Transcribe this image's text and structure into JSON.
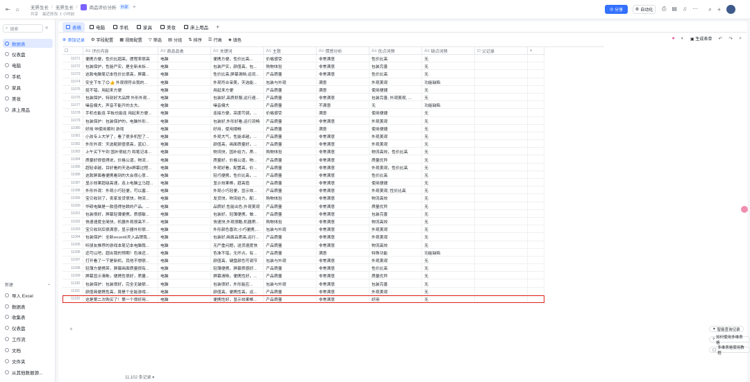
{
  "breadcrumbs": [
    "无界生长",
    "无界生长"
  ],
  "doc_title": "商品评价分析",
  "doc_tag": "外部",
  "doc_sub": [
    "共享",
    "最近修改: 1 小时前"
  ],
  "top": {
    "share": "分享",
    "auto": "自动化"
  },
  "sidebar": {
    "search_placeholder": "搜索",
    "items": [
      {
        "label": "数据表",
        "active": true
      },
      {
        "label": "仪表盘"
      },
      {
        "label": "电脑"
      },
      {
        "label": "手机"
      },
      {
        "label": "家具"
      },
      {
        "label": "美妆"
      },
      {
        "label": "床上用品"
      }
    ],
    "new_section": "新建",
    "new_items": [
      "导入 Excel",
      "数据表",
      "收集表",
      "仪表盘",
      "工作流",
      "文档",
      "文件夹",
      "从其他数据源..."
    ]
  },
  "tabs": [
    "表格",
    "电脑",
    "手机",
    "家具",
    "美妆",
    "床上用品"
  ],
  "toolbar": [
    "添加记录",
    "字段配置",
    "视图配置",
    "筛选",
    "分组",
    "排序",
    "行高",
    "填色"
  ],
  "toolbar_right": {
    "generate": "生成表单"
  },
  "columns": [
    "评价内容",
    "商品品类",
    "关键词",
    "主题",
    "情感分析",
    "优点词频",
    "缺点词频",
    "父记录"
  ],
  "rows": [
    [
      "11071",
      "便携方便，性价比超高，提程率很高",
      "电脑",
      "便携方便，性价比高...",
      "价格感受",
      "非常满意",
      "性价比高",
      "无"
    ],
    [
      "11072",
      "包装保护，性能严实，是全新未拆...",
      "电脑",
      "包装严实，颜值高，包...",
      "购物体验",
      "非常满意",
      "包装完善",
      "无"
    ],
    [
      "11073",
      "这款电脑笔记本性价比很高，屏幕...",
      "电脑",
      "性价比高,屏幕清晰,运流...",
      "产品质量",
      "非常满意",
      "性价比高",
      "无"
    ],
    [
      "11074",
      "安全下车了😊👍 外观很符合我的...",
      "电脑",
      "外观符合审美，天选能...",
      "包装与外观",
      "满意",
      "外观美观",
      "功能缺陷"
    ],
    [
      "11075",
      "挺不错，用起来方便",
      "电脑",
      "用起来方便",
      "产品质量",
      "满意",
      "使用便捷",
      "无"
    ],
    [
      "11076",
      "包装保护，特别好大品牌 外形外观...",
      "电脑",
      "包装好,高质舒服,运行速...",
      "产品质量",
      "非常满意",
      "包装完善, 外观美观, ...",
      "无"
    ],
    [
      "11077",
      "噪音偏大，声音不能开的太大。",
      "电脑",
      "噪音偏大",
      "产品质量",
      "不满意",
      "无",
      "功能缺陷"
    ],
    [
      "11078",
      "手机也能连 平板也能连 用起来方便...",
      "电脑",
      "连接方便，亮度可调，...",
      "价格感受",
      "满意",
      "使用便捷",
      "无"
    ],
    [
      "11079",
      "包装保护：包装保护的，电脑外形...",
      "电脑",
      "包装好,外形好看,运行流畅",
      "产品质量",
      "非常满意",
      "外观美观",
      "无"
    ],
    [
      "11080",
      "好用 响使用顺利 游戏",
      "电脑",
      "好用，使用顺畅",
      "产品质量",
      "满意",
      "使用便捷",
      "无"
    ],
    [
      "11081",
      "小孩专上大学了，看了很多机型了...",
      "电脑",
      "外观大气，性能卓越，...",
      "产品质量",
      "非常满意",
      "外观美观",
      "无"
    ],
    [
      "11082",
      "外形外观：天选配颜值很高，蓝幻...",
      "电脑",
      "颜值高，画面质量好，...",
      "产品质量",
      "非常满意",
      "外观美观",
      "无"
    ],
    [
      "11083",
      "上午买下午到 国补很给力 和笔记本...",
      "电脑",
      "物流快，国补给力，质...",
      "购物体验",
      "非常满意",
      "物流高效，性价比高",
      "无"
    ],
    [
      "11084",
      "质量好很值得说，价格公道，物流...",
      "电脑",
      "质量好，价格公道，物...",
      "产品质量",
      "非常满意",
      "质量优异",
      "无"
    ],
    [
      "11085",
      "超轻卓越，目好看的天选4屏幕过程...",
      "电脑",
      "外观好看，配置高，价...",
      "产品质量",
      "非常满意",
      "外观美观，性价比高",
      "无"
    ],
    [
      "11086",
      "这款屏面看便携看到的大会很心意...",
      "电脑",
      "轻巧便携，性价比高，...",
      "产品质量",
      "非常满意",
      "性价比高",
      "无"
    ],
    [
      "11087",
      "显示效果超级高速，连上电脑立马超...",
      "电脑",
      "显示效果棒，超高值",
      "产品质量",
      "非常满意",
      "使用便捷",
      "无"
    ],
    [
      "11088",
      "外形外观：外观小巧轻便，可以塞...",
      "电脑",
      "外观小巧轻便，显示效...",
      "产品质量",
      "非常满意",
      "外观美观, 性价比高",
      "无"
    ],
    [
      "11089",
      "宝贝收到了，卖家发货很快，物流...",
      "电脑",
      "发货快，物流给力，配...",
      "购物体验",
      "非常满意",
      "物流高效",
      "无"
    ],
    [
      "11090",
      "华硕电脑是一款值得信赖的产品。...",
      "电脑",
      "品质好,性能出色,外观美观",
      "产品质量",
      "非常满意",
      "质量优异",
      "无"
    ],
    [
      "11091",
      "包装很好，屏幕轻薄便携，质感敏...",
      "电脑",
      "包装好，轻薄便携，做...",
      "产品质量",
      "非常满意",
      "包装完善",
      "无"
    ],
    [
      "11092",
      "快速速度全简快，机器外观很高不...",
      "电脑",
      "快速快,外观很酷,机器质...",
      "购物体验",
      "非常满意",
      "物流高效",
      "无"
    ],
    [
      "11093",
      "宝贝收到后很满意，显示器外形很...",
      "电脑",
      "外形颜色喜欢,小巧便携,...",
      "包装与外观",
      "非常满意",
      "外观美观",
      "无"
    ],
    [
      "11094",
      "包装保护：全新recent6天入品牌我...",
      "电脑",
      "包装好,画面品质高,运行...",
      "产品质量",
      "非常满意",
      "外观美观",
      "无"
    ],
    [
      "11095",
      "听朋友推荐的游戏本笔记本电脑我...",
      "电脑",
      "无严重问题，送货速度快",
      "产品质量",
      "非常满意",
      "物流高效",
      "无"
    ],
    [
      "11096",
      "还可以吧，超出我的预期！色准还...",
      "电脑",
      "色准不错，无坏点，有...",
      "产品质量",
      "满意",
      "特殊功能",
      "功能缺陷"
    ],
    [
      "11097",
      "打开看了一下是新机，其他不想很...",
      "电脑",
      "颜值高，键盘颜色可调节",
      "包装与外观",
      "非常满意",
      "外观美观",
      "无"
    ],
    [
      "11098",
      "轻薄方便携带，屏幕画面质量很有...",
      "电脑",
      "轻薄便携，屏幕质感好...",
      "产品质量",
      "非常满意",
      "性价比高",
      "无"
    ],
    [
      "11099",
      "屏幕显示清晰，便携性很好，质量...",
      "电脑",
      "屏幕清晰，便携性好，...",
      "产品质量",
      "非常满意",
      "质量优异",
      "无"
    ],
    [
      "11100",
      "包装保护：包装很好，完全无破损...",
      "电脑",
      "包装很好，外形能应...",
      "包装与外观",
      "非常满意",
      "包装完善",
      "无"
    ],
    [
      "11101",
      "颜值简便携性高，算是个全能游戏...",
      "电脑",
      "颜值高，便携性高，运...",
      "产品质量",
      "非常满意",
      "外观美观",
      "无"
    ],
    [
      "11102",
      "这是第二次购买了！第一个很好用...",
      "电脑",
      "便携性好，显示效果棒...",
      "产品质量",
      "非常满意",
      "好用",
      "无"
    ]
  ],
  "footer": "11,102 条记录",
  "fabs": [
    "智能查询记录",
    "如何使用多维表格",
    "多维表格使用教程"
  ]
}
